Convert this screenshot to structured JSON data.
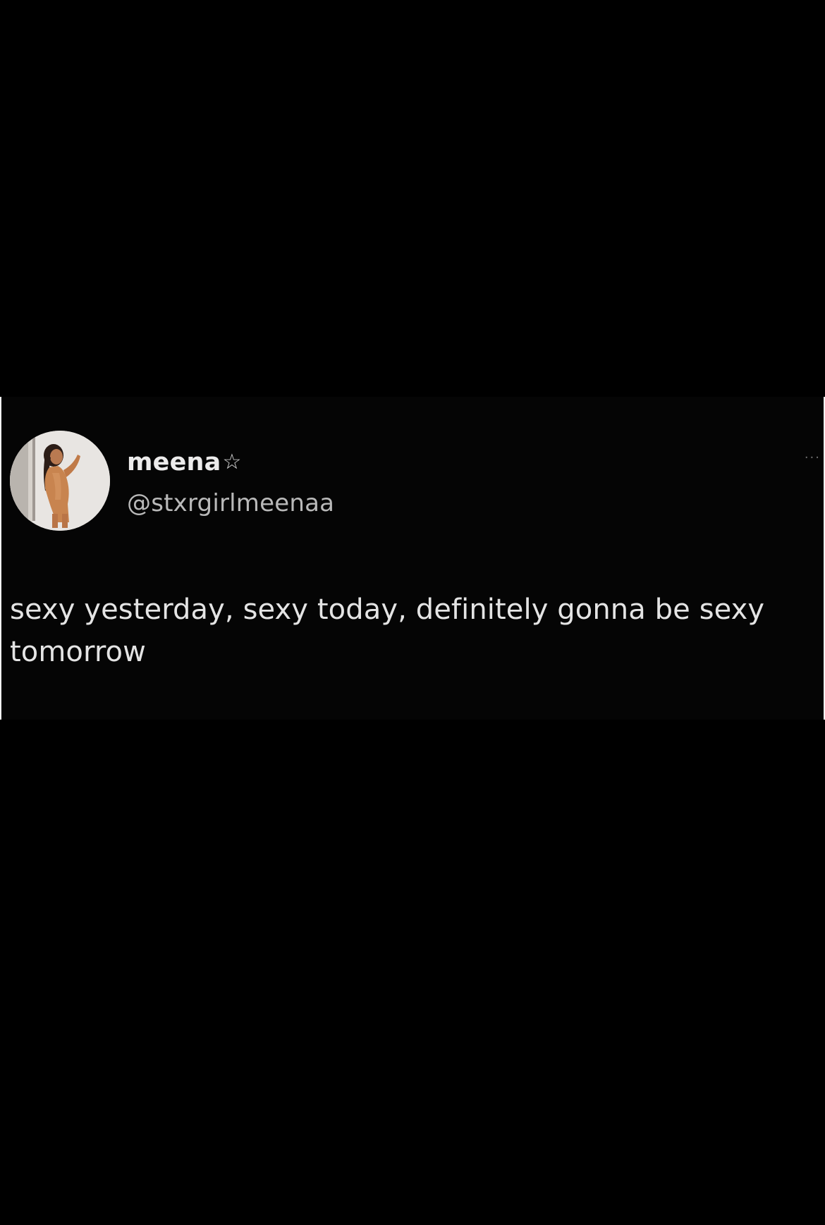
{
  "tweet": {
    "display_name": "meena",
    "badge_icon": "star-outline-icon",
    "badge_glyph": "☆",
    "handle": "@stxrgirlmeenaa",
    "more_glyph": "···",
    "text": "sexy yesterday, sexy today, definitely gonna be sexy tomorrow"
  },
  "colors": {
    "background": "#000000",
    "card_border": "#f2f2f2",
    "name_text": "#ecebeb",
    "handle_text": "#b9b9b9",
    "body_text": "#e4e4e4"
  }
}
